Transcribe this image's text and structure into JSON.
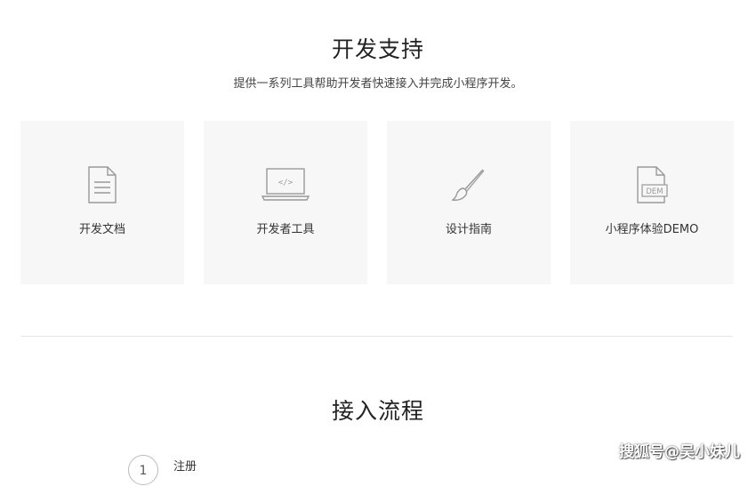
{
  "support": {
    "title": "开发支持",
    "subtitle": "提供一系列工具帮助开发者快速接入并完成小程序开发。",
    "cards": [
      {
        "label": "开发文档",
        "icon": "document-icon"
      },
      {
        "label": "开发者工具",
        "icon": "laptop-code-icon",
        "icon_text": "</>"
      },
      {
        "label": "设计指南",
        "icon": "paintbrush-icon"
      },
      {
        "label": "小程序体验DEMO",
        "icon": "demo-file-icon",
        "icon_text": "DEM"
      }
    ]
  },
  "process": {
    "title": "接入流程",
    "steps": [
      {
        "number": "1",
        "label": "注册"
      }
    ]
  },
  "watermark": "搜狐号@吴小妹儿",
  "colors": {
    "card_bg": "#f7f7f7",
    "icon_stroke": "#999999",
    "divider": "#e6e6e6"
  }
}
